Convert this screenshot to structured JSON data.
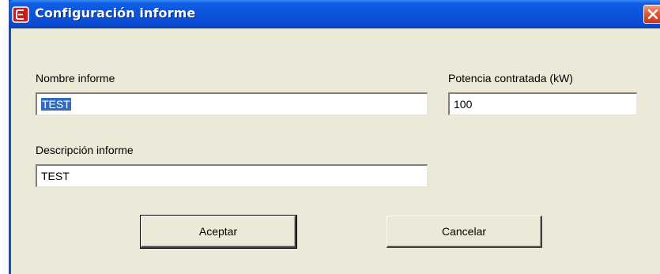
{
  "window": {
    "title": "Configuración informe",
    "icon": "app-icon",
    "close_icon": "close-icon"
  },
  "form": {
    "nombre": {
      "label": "Nombre informe",
      "value": "TEST"
    },
    "potencia": {
      "label": "Potencia contratada (kW)",
      "value": "100"
    },
    "descripcion": {
      "label": "Descripción informe",
      "value": "TEST"
    }
  },
  "buttons": {
    "accept_label": "Aceptar",
    "cancel_label": "Cancelar"
  },
  "colors": {
    "titlebar": "#0a4fd6",
    "dialog_background": "#ece9d8",
    "selection": "#316ac5",
    "close_button": "#e2593b"
  }
}
